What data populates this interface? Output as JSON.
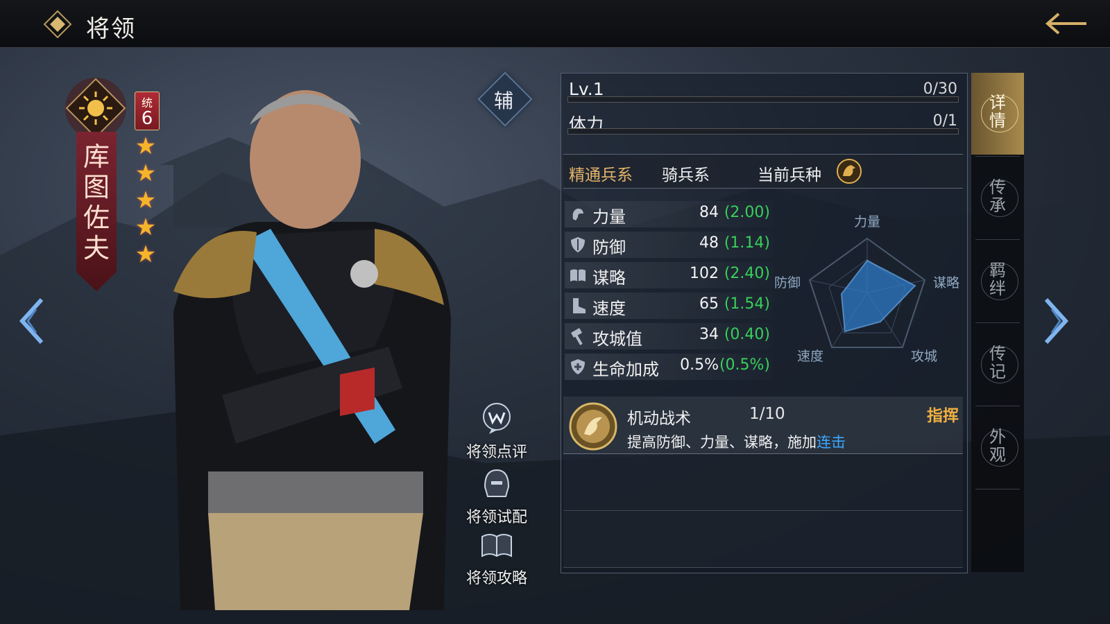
{
  "header": {
    "title": "将领"
  },
  "general": {
    "name_chars": [
      "库",
      "图",
      "佐",
      "夫"
    ],
    "tong_label": "统",
    "tong_value": "6",
    "stars": 5,
    "role": "辅"
  },
  "side_actions": {
    "review": "将领点评",
    "trial": "将领试配",
    "guide": "将领攻略"
  },
  "level": {
    "label": "Lv.1",
    "value": "0/30",
    "progress": 0
  },
  "stamina": {
    "label": "体力",
    "value": "0/1",
    "progress": 0
  },
  "troop": {
    "mastery_label": "精通兵系",
    "mastery_value": "骑兵系",
    "current_label": "当前兵种"
  },
  "stats": [
    {
      "name": "力量",
      "value": "84",
      "growth": "(2.00)",
      "icon": "fist-icon"
    },
    {
      "name": "防御",
      "value": "48",
      "growth": "(1.14)",
      "icon": "shield-icon"
    },
    {
      "name": "谋略",
      "value": "102",
      "growth": "(2.40)",
      "icon": "book-icon"
    },
    {
      "name": "速度",
      "value": "65",
      "growth": "(1.54)",
      "icon": "boot-icon"
    },
    {
      "name": "攻城值",
      "value": "34",
      "growth": "(0.40)",
      "icon": "hammer-icon"
    },
    {
      "name": "生命加成",
      "value": "0.5%",
      "growth": "(0.5%)",
      "icon": "health-icon"
    }
  ],
  "radar": {
    "labels": {
      "top": "力量",
      "left": "防御",
      "right": "谋略",
      "bottom_left": "速度",
      "bottom_right": "攻城"
    }
  },
  "skill": {
    "name": "机动战术",
    "level": "1/10",
    "type": "指挥",
    "desc": "提高防御、力量、谋略，施加",
    "desc_link": "连击"
  },
  "tabs": [
    {
      "label": "详情",
      "active": true
    },
    {
      "label": "传承",
      "active": false
    },
    {
      "label": "羁绊",
      "active": false
    },
    {
      "label": "传记",
      "active": false
    },
    {
      "label": "外观",
      "active": false
    }
  ],
  "colors": {
    "accent_gold": "#e5b46a",
    "growth_green": "#37d05a",
    "link_blue": "#3aa8ff",
    "skill_type": "#f0b040"
  }
}
